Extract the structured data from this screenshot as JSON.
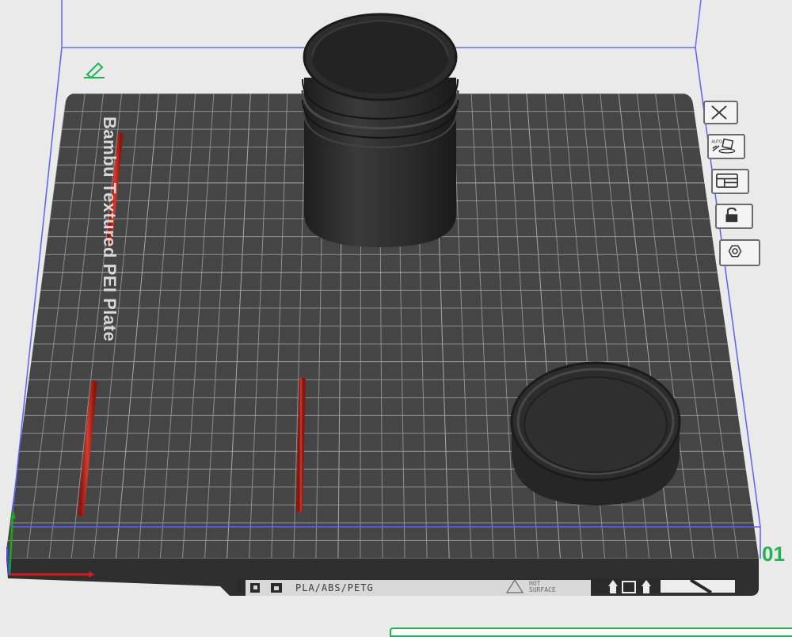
{
  "plate": {
    "label": "Bambu Textured PEI Plate",
    "number": "01",
    "filament_text": "PLA/ABS/PETG",
    "warning_line1": "HOT",
    "warning_line2": "SURFACE"
  },
  "toolbar": {
    "items": [
      {
        "name": "close-plate-button",
        "icon": "close-icon"
      },
      {
        "name": "auto-orient-button",
        "icon": "auto-orient-icon"
      },
      {
        "name": "arrange-button",
        "icon": "arrange-icon"
      },
      {
        "name": "lock-plate-button",
        "icon": "lock-icon"
      },
      {
        "name": "plate-settings-button",
        "icon": "gear-nut-icon"
      }
    ]
  },
  "colors": {
    "plate": "#454545",
    "grid": "#8e8e8e",
    "bounding_box": "#5e5eff",
    "object": "#2f2f2f",
    "support_rod": "#c2271c",
    "plate_number": "#1fb451"
  }
}
